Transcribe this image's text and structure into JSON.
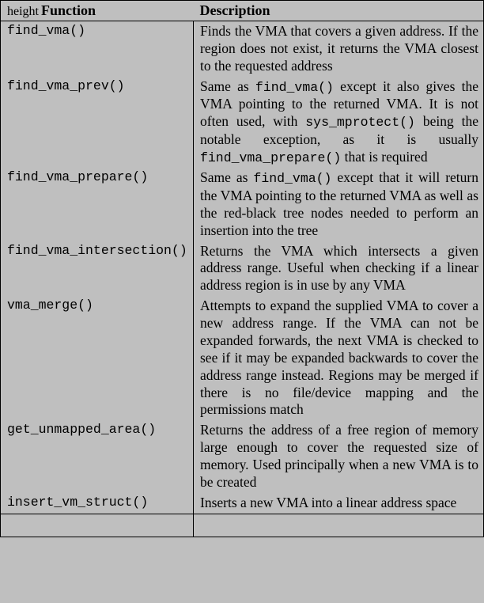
{
  "header": {
    "heightlabel": "height",
    "col1": "Function",
    "col2": "Description"
  },
  "rows": [
    {
      "func": "find_vma()",
      "desc_pre": "Finds the VMA that covers a given address. If the region does not exist, it returns the VMA closest to the requested address"
    },
    {
      "func": "find_vma_prev()",
      "desc_pre": "Same as ",
      "tt1": "find_vma()",
      "desc_mid1": " except it also gives the VMA pointing to the returned VMA. It is not often used, with ",
      "tt2": "sys_mprotect()",
      "desc_mid2": " being the notable exception, as it is usually ",
      "tt3": "find_vma_prepare()",
      "desc_post": " that is required"
    },
    {
      "func": "find_vma_prepare()",
      "desc_pre": "Same as ",
      "tt1": "find_vma()",
      "desc_post": " except that it will return the VMA pointing to the returned VMA as well as the red-black tree nodes needed to perform an insertion into the tree"
    },
    {
      "func": "find_vma_intersection()",
      "desc_pre": "Returns the VMA which intersects a given address range. Useful when checking if a linear address region is in use by any VMA"
    },
    {
      "func": "vma_merge()",
      "desc_pre": "Attempts to expand the supplied VMA to cover a new address range. If the VMA can not be expanded forwards, the next VMA is checked to see if it may be expanded backwards to cover the address range instead. Regions may be merged if there is no file/device mapping and the permissions match"
    },
    {
      "func": "get_unmapped_area()",
      "desc_pre": "Returns the address of a free region of memory large enough to cover the requested size of memory. Used principally when a new VMA is to be created"
    },
    {
      "func": "insert_vm_struct()",
      "desc_pre": "Inserts a new VMA into a linear address space"
    }
  ]
}
